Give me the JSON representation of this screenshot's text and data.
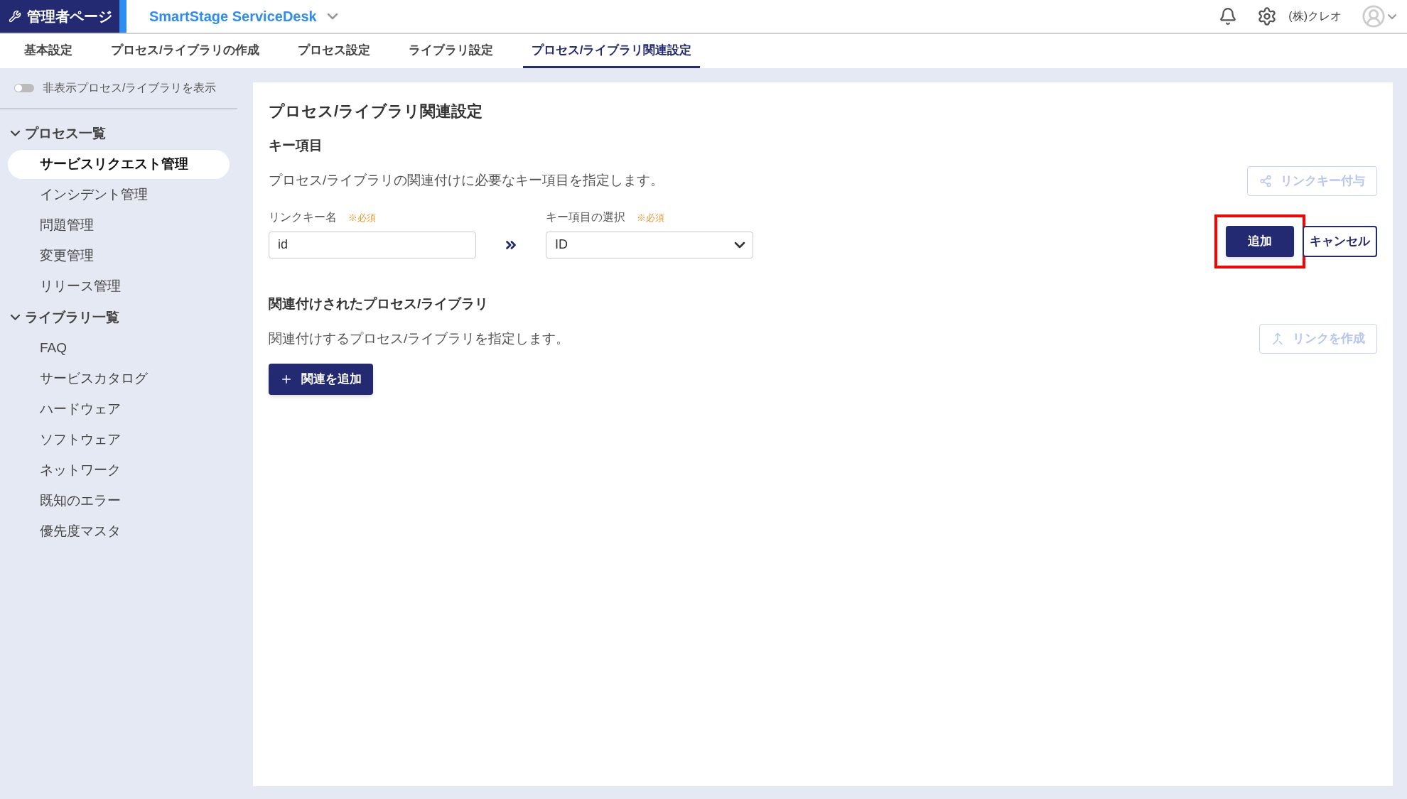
{
  "header": {
    "admin_label": "管理者ページ",
    "app_name": "SmartStage ServiceDesk",
    "company": "(株)クレオ"
  },
  "tabs": [
    {
      "label": "基本設定",
      "selected": false
    },
    {
      "label": "プロセス/ライブラリの作成",
      "selected": false
    },
    {
      "label": "プロセス設定",
      "selected": false
    },
    {
      "label": "ライブラリ設定",
      "selected": false
    },
    {
      "label": "プロセス/ライブラリ関連設定",
      "selected": true
    }
  ],
  "sidebar": {
    "toggle": {
      "label": "非表示プロセス/ライブラリを表示",
      "on": false
    },
    "sections": [
      {
        "title": "プロセス一覧",
        "expanded": true,
        "items": [
          {
            "label": "サービスリクエスト管理",
            "selected": true
          },
          {
            "label": "インシデント管理",
            "selected": false
          },
          {
            "label": "問題管理",
            "selected": false
          },
          {
            "label": "変更管理",
            "selected": false
          },
          {
            "label": "リリース管理",
            "selected": false
          }
        ]
      },
      {
        "title": "ライブラリ一覧",
        "expanded": true,
        "items": [
          {
            "label": "FAQ",
            "selected": false
          },
          {
            "label": "サービスカタログ",
            "selected": false
          },
          {
            "label": "ハードウェア",
            "selected": false
          },
          {
            "label": "ソフトウェア",
            "selected": false
          },
          {
            "label": "ネットワーク",
            "selected": false
          },
          {
            "label": "既知のエラー",
            "selected": false
          },
          {
            "label": "優先度マスタ",
            "selected": false
          }
        ]
      }
    ]
  },
  "main": {
    "title": "プロセス/ライブラリ関連設定",
    "key_section": {
      "heading": "キー項目",
      "description": "プロセス/ライブラリの関連付けに必要なキー項目を指定します。",
      "link_key_button": {
        "label": "リンクキー付与",
        "disabled": true
      },
      "link_key_name": {
        "label": "リンクキー名",
        "required": "※必須",
        "value": "id"
      },
      "key_select": {
        "label": "キー項目の選択",
        "required": "※必須",
        "value": "ID"
      },
      "add_button": {
        "label": "追加",
        "highlighted": true
      },
      "cancel_button": {
        "label": "キャンセル"
      }
    },
    "relation_section": {
      "heading": "関連付けされたプロセス/ライブラリ",
      "description": "関連付けするプロセス/ライブラリを指定します。",
      "create_link_button": {
        "label": "リンクを作成",
        "disabled": true
      },
      "add_relation_button": {
        "label": "関連を追加"
      }
    }
  }
}
